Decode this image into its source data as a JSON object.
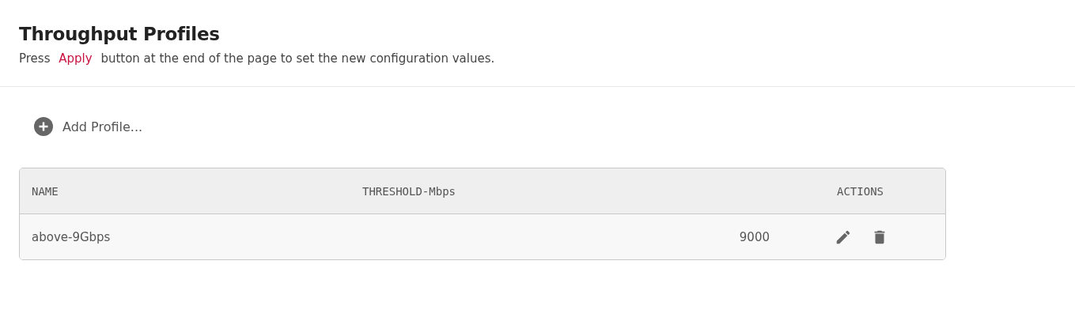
{
  "header": {
    "title": "Throughput Profiles",
    "hint": {
      "before": "Press",
      "link": "Apply",
      "after": "button at the end of the page to set the new configuration values."
    }
  },
  "add_button": {
    "label": "Add Profile..."
  },
  "table": {
    "columns": [
      "NAME",
      "THRESHOLD-Mbps",
      "ACTIONS"
    ],
    "rows": [
      {
        "name": "above-9Gbps",
        "threshold": "9000"
      }
    ]
  }
}
